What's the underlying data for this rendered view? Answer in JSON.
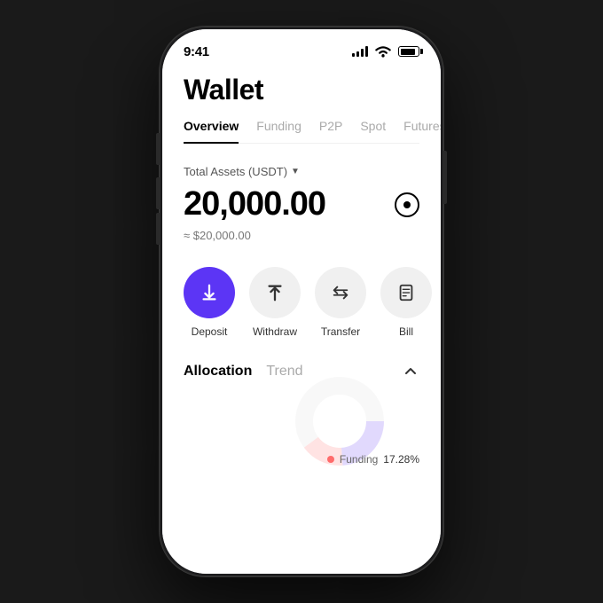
{
  "statusBar": {
    "time": "9:41",
    "icons": {
      "signal": "signal-icon",
      "wifi": "wifi-icon",
      "battery": "battery-icon"
    }
  },
  "header": {
    "title": "Wallet"
  },
  "tabs": [
    {
      "label": "Overview",
      "active": true
    },
    {
      "label": "Funding",
      "active": false
    },
    {
      "label": "P2P",
      "active": false
    },
    {
      "label": "Spot",
      "active": false
    },
    {
      "label": "Futures",
      "active": false
    }
  ],
  "assets": {
    "label": "Total Assets (USDT)",
    "amount": "20,000.00",
    "approx": "≈ $20,000.00"
  },
  "actions": [
    {
      "label": "Deposit",
      "icon": "deposit-icon",
      "variant": "purple"
    },
    {
      "label": "Withdraw",
      "icon": "withdraw-icon",
      "variant": "gray"
    },
    {
      "label": "Transfer",
      "icon": "transfer-icon",
      "variant": "gray"
    },
    {
      "label": "Bill",
      "icon": "bill-icon",
      "variant": "gray"
    }
  ],
  "allocation": {
    "tabs": [
      {
        "label": "Allocation",
        "active": true
      },
      {
        "label": "Trend",
        "active": false
      }
    ],
    "funding": {
      "dot_color": "#ff6b6b",
      "label": "Funding",
      "percentage": "17.28%"
    }
  },
  "colors": {
    "accent_purple": "#5c35f5",
    "gray_btn": "#f0f0f0",
    "text_primary": "#000000",
    "text_secondary": "#777777"
  }
}
